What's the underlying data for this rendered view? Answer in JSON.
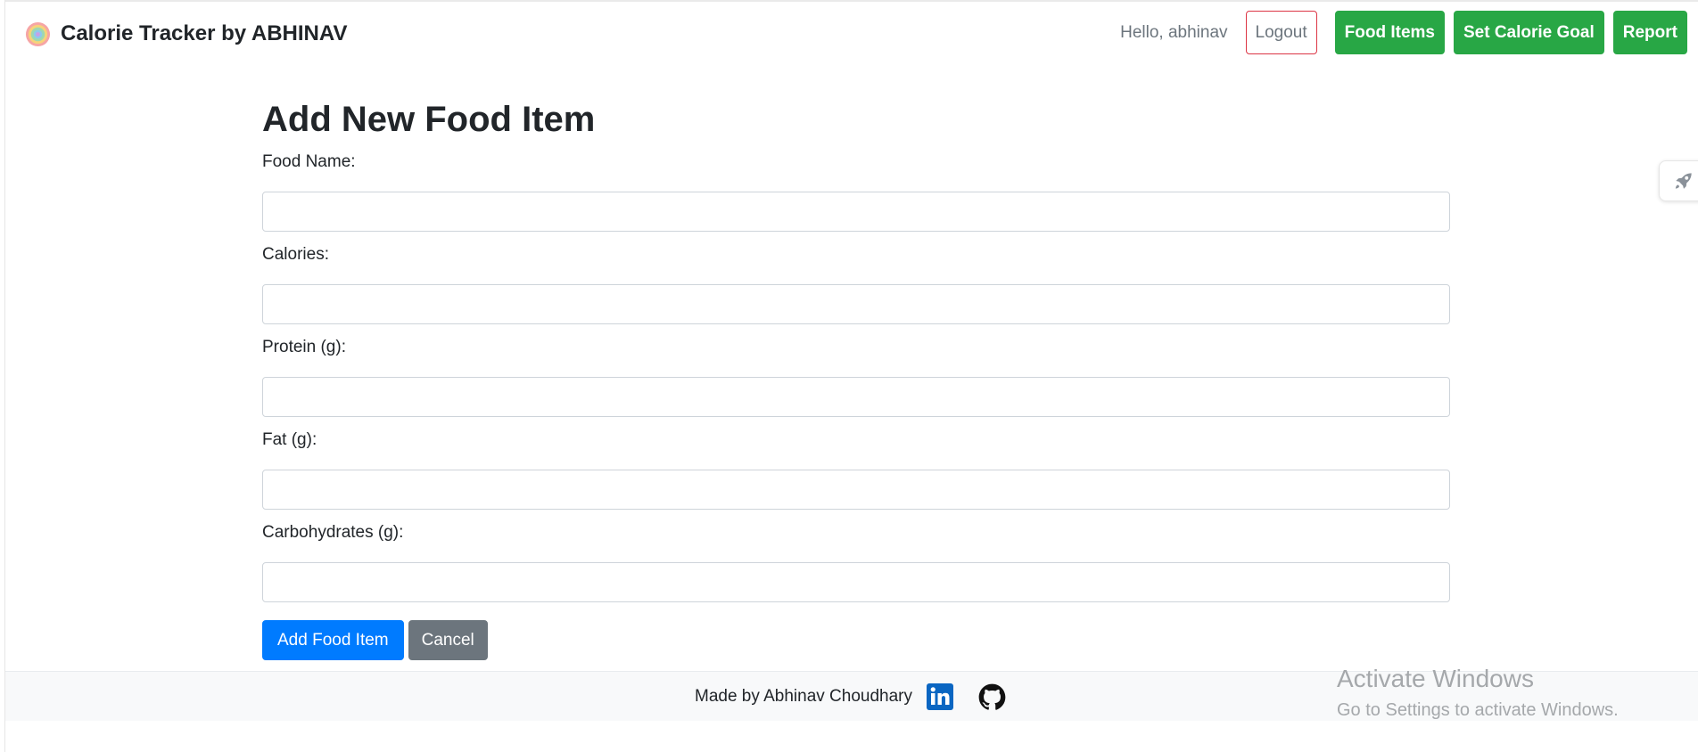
{
  "navbar": {
    "brand": "Calorie Tracker by ABHINAV",
    "greeting": "Hello, abhinav",
    "logout": "Logout",
    "links": [
      "Food Items",
      "Set Calorie Goal",
      "Report"
    ]
  },
  "form": {
    "title": "Add New Food Item",
    "fields": [
      {
        "label": "Food Name:",
        "value": ""
      },
      {
        "label": "Calories:",
        "value": ""
      },
      {
        "label": "Protein (g):",
        "value": ""
      },
      {
        "label": "Fat (g):",
        "value": ""
      },
      {
        "label": "Carbohydrates (g):",
        "value": ""
      }
    ],
    "submit": "Add Food Item",
    "cancel": "Cancel"
  },
  "footer": {
    "text": "Made by Abhinav Choudhary",
    "icons": [
      "linkedin-icon",
      "github-icon"
    ]
  },
  "side_widget": {
    "icon": "rocket-icon"
  },
  "watermark": {
    "title": "Activate Windows",
    "subtitle": "Go to Settings to activate Windows."
  },
  "colors": {
    "green": "#28a745",
    "primary": "#007bff",
    "secondary": "#6c757d",
    "danger": "#dc3545",
    "linkedin": "#0a66c2"
  }
}
